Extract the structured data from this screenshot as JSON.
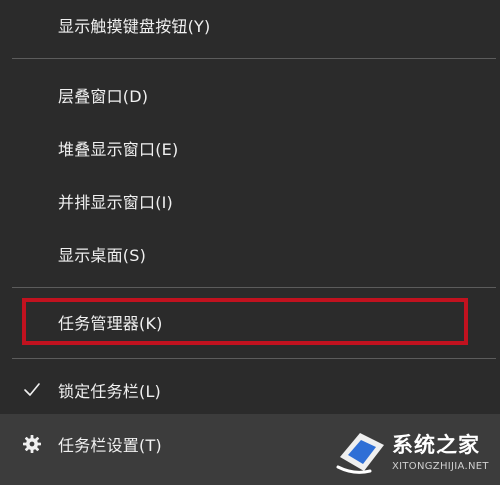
{
  "menu": {
    "items": [
      {
        "label": "显示触摸键盘按钮(Y)"
      },
      {
        "label": "层叠窗口(D)"
      },
      {
        "label": "堆叠显示窗口(E)"
      },
      {
        "label": "并排显示窗口(I)"
      },
      {
        "label": "显示桌面(S)"
      },
      {
        "label": "任务管理器(K)"
      },
      {
        "label": "锁定任务栏(L)",
        "checked": true,
        "icon": "check-icon"
      },
      {
        "label": "任务栏设置(T)",
        "icon": "gear-icon"
      }
    ]
  },
  "colors": {
    "menu_bg": "#2b2b2b",
    "text": "#f0f0f0",
    "separator": "#5c5c5c",
    "highlight_border": "#c1121f",
    "hover_bg": "#3c3c3c"
  },
  "watermark": {
    "title": "系统之家",
    "subtitle": "XITONGZHIJIA.NET"
  }
}
